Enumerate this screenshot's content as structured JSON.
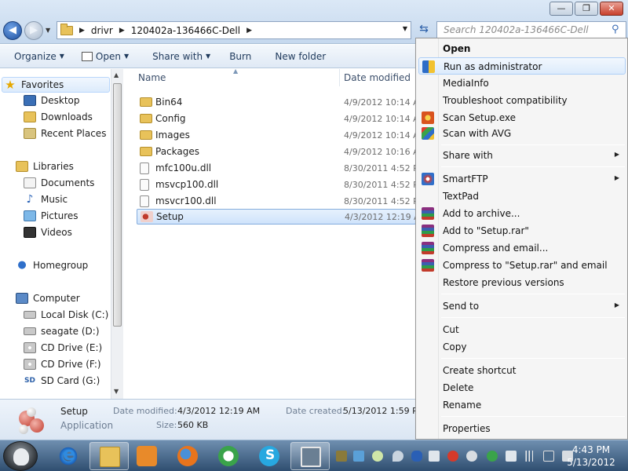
{
  "window": {
    "address": {
      "crumbs": [
        "drivr",
        "120402a-136466C-Dell"
      ]
    },
    "search": {
      "placeholder": "Search 120402a-136466C-Dell"
    },
    "controls": {
      "minimize": "—",
      "maximize": "❐",
      "close": "✕"
    }
  },
  "toolbar": {
    "organize": "Organize",
    "open": "Open",
    "share_with": "Share with",
    "burn": "Burn",
    "new_folder": "New folder"
  },
  "sidebar": {
    "favorites": {
      "label": "Favorites",
      "items": [
        "Desktop",
        "Downloads",
        "Recent Places"
      ]
    },
    "libraries": {
      "label": "Libraries",
      "items": [
        "Documents",
        "Music",
        "Pictures",
        "Videos"
      ]
    },
    "homegroup": "Homegroup",
    "computer": {
      "label": "Computer",
      "items": [
        "Local Disk (C:)",
        "seagate (D:)",
        "CD Drive (E:)",
        "CD Drive (F:)",
        "SD Card (G:)"
      ]
    }
  },
  "filelist": {
    "columns": {
      "name": "Name",
      "date": "Date modified"
    },
    "rows": [
      {
        "name": "Bin64",
        "date": "4/9/2012 10:14 AM",
        "type": "folder"
      },
      {
        "name": "Config",
        "date": "4/9/2012 10:14 AM",
        "type": "folder"
      },
      {
        "name": "Images",
        "date": "4/9/2012 10:14 AM",
        "type": "folder"
      },
      {
        "name": "Packages",
        "date": "4/9/2012 10:16 AM",
        "type": "folder"
      },
      {
        "name": "mfc100u.dll",
        "date": "8/30/2011 4:52 PM",
        "type": "dll"
      },
      {
        "name": "msvcp100.dll",
        "date": "8/30/2011 4:52 PM",
        "type": "dll"
      },
      {
        "name": "msvcr100.dll",
        "date": "8/30/2011 4:52 PM",
        "type": "dll"
      },
      {
        "name": "Setup",
        "date": "4/3/2012 12:19 AM",
        "type": "setup"
      }
    ]
  },
  "details": {
    "name": "Setup",
    "type": "Application",
    "modified_label": "Date modified:",
    "modified_value": "4/3/2012 12:19 AM",
    "created_label": "Date created:",
    "created_value": "5/13/2012 1:59 PM",
    "size_label": "Size:",
    "size_value": "560 KB"
  },
  "context_menu": {
    "open": "Open",
    "run_as_admin": "Run as administrator",
    "mediainfo": "MediaInfo",
    "troubleshoot": "Troubleshoot compatibility",
    "scan_setup": "Scan Setup.exe",
    "scan_avg": "Scan with AVG",
    "share_with": "Share with",
    "smartftp": "SmartFTP",
    "textpad": "TextPad",
    "add_archive": "Add to archive...",
    "add_rar": "Add to \"Setup.rar\"",
    "compress_email": "Compress and email...",
    "compress_rar_email": "Compress to \"Setup.rar\" and email",
    "restore": "Restore previous versions",
    "send_to": "Send to",
    "cut": "Cut",
    "copy": "Copy",
    "create_shortcut": "Create shortcut",
    "delete": "Delete",
    "rename": "Rename",
    "properties": "Properties"
  },
  "taskbar": {
    "time": "4:43 PM",
    "date": "5/13/2012"
  },
  "colors": {
    "accent": "#2b5fa8",
    "selection": "#cfe3fb",
    "taskbar": "#2f4e70"
  }
}
